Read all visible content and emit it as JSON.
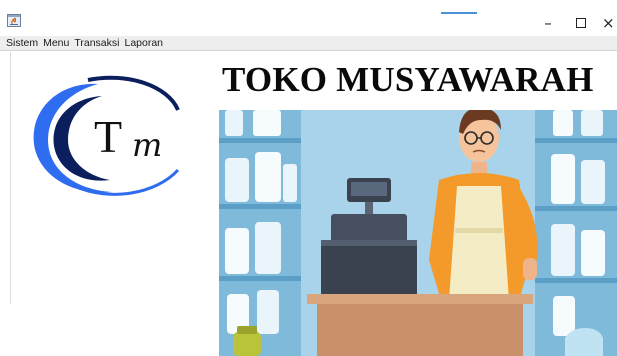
{
  "window": {
    "minimize_symbol": "–",
    "close_symbol": "×",
    "accent_color": "#4a90d9"
  },
  "menu": {
    "items": [
      "Sistem",
      "Menu",
      "Transaksi",
      "Laporan"
    ]
  },
  "main": {
    "store_title": "TOKO MUSYAWARAH"
  },
  "logo": {
    "text": "Tm",
    "colors": {
      "navy": "#0b1f5c",
      "blue": "#2f6df0",
      "letter": "#111111"
    }
  },
  "illustration": {
    "subject": "shopkeeper-at-cash-register",
    "colors": {
      "shelf": "#7fbadb",
      "wall": "#cfe8f4",
      "counter": "#c8916a",
      "register": "#3a4250",
      "apron": "#f4ecc4",
      "shirt": "#f39a2a"
    }
  }
}
